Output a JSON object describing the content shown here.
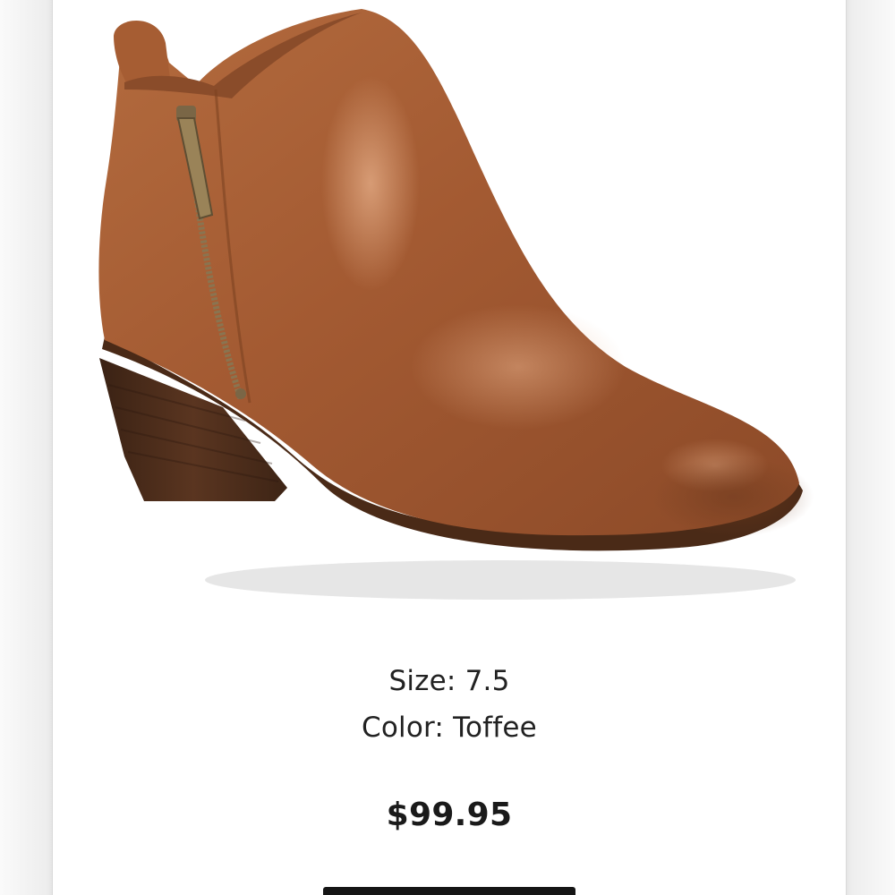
{
  "product": {
    "image_alt": "Toffee leather ankle bootie with side zipper and stacked heel",
    "size_label": "Size:",
    "size_value": "7.5",
    "color_label": "Color:",
    "color_value": "Toffee",
    "price": "$99.95"
  },
  "colors": {
    "leather": "#a45d34",
    "sole": "#4e2d1a",
    "zipper": "#8a7450",
    "cta_background": "#151515"
  }
}
